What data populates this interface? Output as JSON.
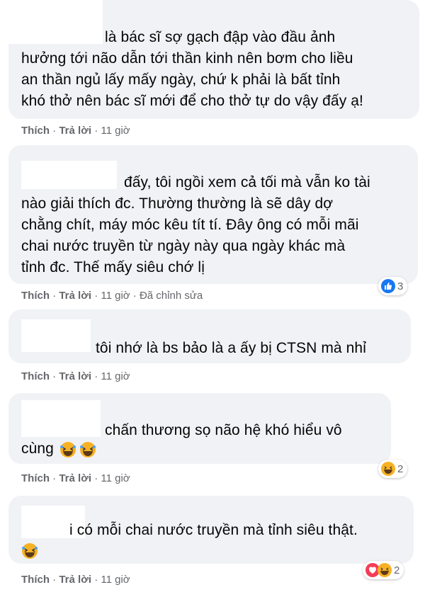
{
  "comments": [
    {
      "lines": [
        "là bác sĩ sợ gạch đập vào đầu ảnh",
        "hưởng tới não dẫn tới thần kinh nên bơm cho liều",
        "an thần ngủ lấy mấy ngày, chứ k phải là bất tỉnh",
        "khó thở nên bác sĩ mới để cho thở tự do vậy đấy ạ!"
      ],
      "meta": {
        "like": "Thích",
        "reply": "Trả lời",
        "time": "11 giờ"
      }
    },
    {
      "lines": [
        "đấy, tôi ngồi xem cả tối mà vẫn ko tài",
        "nào giải thích đc. Thường thường là sẽ dây dợ",
        "chằng chít, máy móc kêu tít tí. Đây ông có mỗi mãi",
        "chai nước truyền từ ngày này qua ngày khác mà",
        "tỉnh đc. Thế mấy siêu chớ lị"
      ],
      "meta": {
        "like": "Thích",
        "reply": "Trả lời",
        "time": "11 giờ",
        "edited": "Đã chỉnh sửa"
      },
      "reaction": {
        "icons": [
          "like-icon"
        ],
        "count": "3"
      }
    },
    {
      "lines": [
        "tôi nhớ là bs bảo là a ấy bị CTSN mà nhỉ"
      ],
      "meta": {
        "like": "Thích",
        "reply": "Trả lời",
        "time": "11 giờ"
      }
    },
    {
      "lines": [
        "chấn thương sọ não hệ khó hiểu vô",
        "cùng"
      ],
      "meta": {
        "like": "Thích",
        "reply": "Trả lời",
        "time": "11 giờ"
      },
      "reaction": {
        "icons": [
          "haha-icon"
        ],
        "count": "2"
      }
    },
    {
      "lines": [
        "i có mỗi chai nước truyền mà tỉnh siêu thật."
      ],
      "meta": {
        "like": "Thích",
        "reply": "Trả lời",
        "time": "11 giờ"
      },
      "reaction": {
        "icons": [
          "love-icon",
          "haha-icon"
        ],
        "count": "2"
      }
    }
  ],
  "colors": {
    "bubble": "#f0f2f5",
    "meta": "#65676b",
    "like": "#1877f2",
    "haha": "#f7b125",
    "love": "#f33e58"
  }
}
